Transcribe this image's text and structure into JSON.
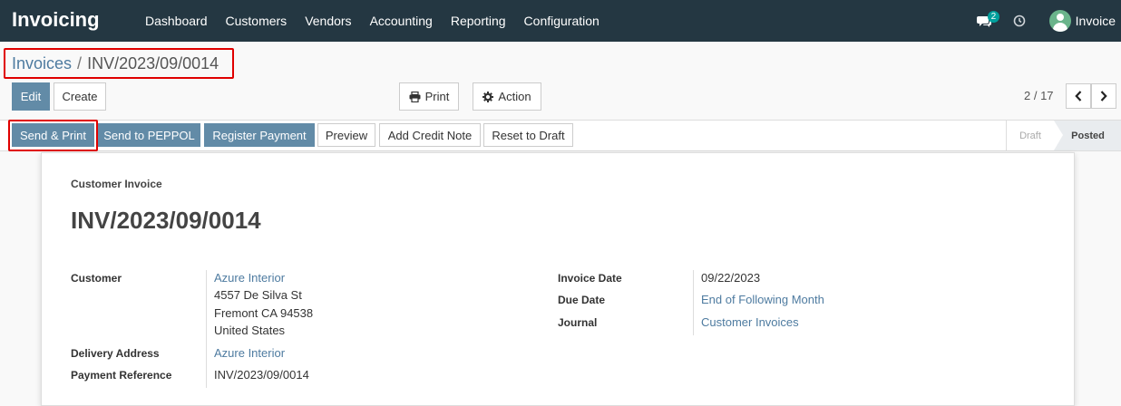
{
  "navbar": {
    "app_title": "Invoicing",
    "menu": [
      "Dashboard",
      "Customers",
      "Vendors",
      "Accounting",
      "Reporting",
      "Configuration"
    ],
    "chat_count": "2",
    "user_name": "Invoice",
    "bg_color": "#243742"
  },
  "breadcrumb": {
    "parent": "Invoices",
    "separator": "/",
    "current": "INV/2023/09/0014"
  },
  "controls": {
    "edit": "Edit",
    "create": "Create",
    "print": "Print",
    "action": "Action",
    "pager": "2 / 17"
  },
  "statusbar": {
    "buttons": [
      "Send & Print",
      "Send to PEPPOL",
      "Register Payment",
      "Preview",
      "Add Credit Note",
      "Reset to Draft"
    ],
    "stages": [
      "Draft",
      "Posted"
    ],
    "active_stage": "Posted"
  },
  "sheet": {
    "doc_type": "Customer Invoice",
    "doc_name": "INV/2023/09/0014",
    "left": {
      "customer_label": "Customer",
      "customer_name": "Azure Interior",
      "address_lines": [
        "4557 De Silva St",
        "Fremont CA 94538",
        "United States"
      ],
      "delivery_label": "Delivery Address",
      "delivery_value": "Azure Interior",
      "payment_ref_label": "Payment Reference",
      "payment_ref_value": "INV/2023/09/0014"
    },
    "right": {
      "invoice_date_label": "Invoice Date",
      "invoice_date_value": "09/22/2023",
      "due_date_label": "Due Date",
      "due_date_value": "End of Following Month",
      "journal_label": "Journal",
      "journal_value": "Customer Invoices"
    }
  },
  "colors": {
    "accent": "#628ba7",
    "link": "#4e7ba0",
    "highlight": "#e00000"
  }
}
